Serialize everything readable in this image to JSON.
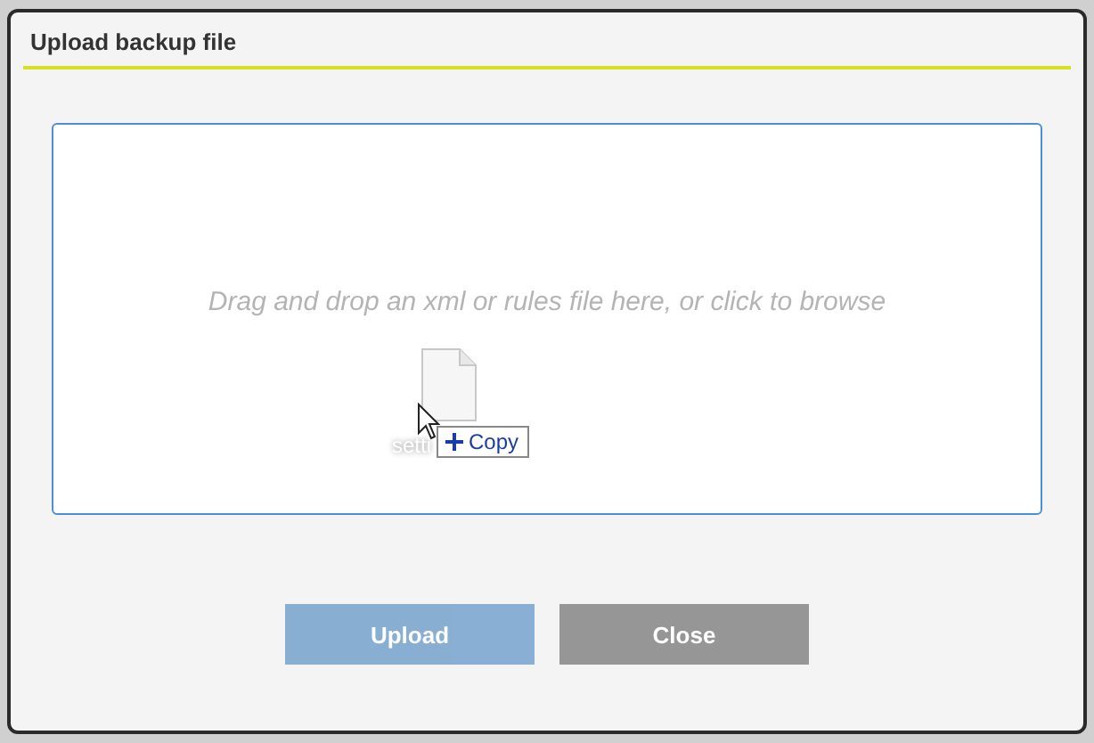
{
  "dialog": {
    "title": "Upload backup file"
  },
  "dropzone": {
    "prompt": "Drag and drop an xml or rules file here, or click to browse"
  },
  "drag": {
    "file_label": "setti",
    "effect": "Copy"
  },
  "buttons": [
    {
      "label": "Upload",
      "kind": "primary",
      "disabled": true
    },
    {
      "label": "Close",
      "kind": "secondary",
      "disabled": false
    }
  ]
}
